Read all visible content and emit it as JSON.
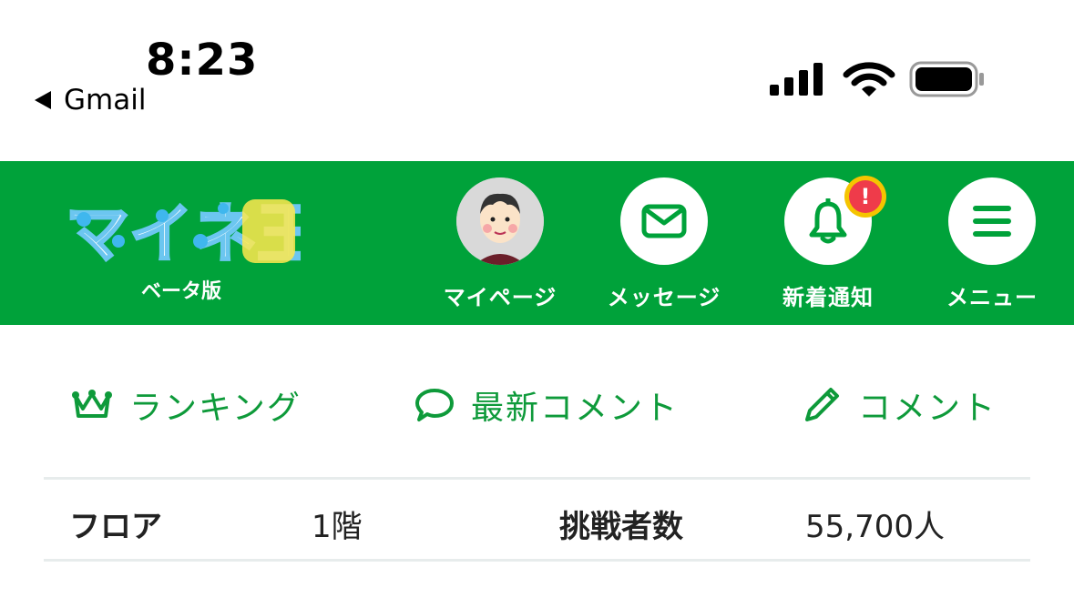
{
  "status_bar": {
    "time": "8:23",
    "back_app": "Gmail",
    "icons": [
      "cellular-signal-icon",
      "wifi-icon",
      "battery-icon"
    ]
  },
  "header": {
    "logo_text": "マイネ王",
    "logo_sub": "ベータ版",
    "nav": [
      {
        "label": "マイページ",
        "icon": "avatar"
      },
      {
        "label": "メッセージ",
        "icon": "mail-icon"
      },
      {
        "label": "新着通知",
        "icon": "bell-icon",
        "badge": "!"
      },
      {
        "label": "メニュー",
        "icon": "hamburger-icon"
      }
    ],
    "colors": {
      "brand": "#00a23a",
      "badge_outer": "#f5c400",
      "badge_inner": "#ef3b4a"
    }
  },
  "sub_nav": [
    {
      "label": "ランキング",
      "icon": "crown-icon"
    },
    {
      "label": "最新コメント",
      "icon": "speech-bubble-icon"
    },
    {
      "label": "コメント",
      "icon": "pencil-icon"
    }
  ],
  "info": {
    "floor_label": "フロア",
    "floor_value": "1階",
    "challengers_label": "挑戦者数",
    "challengers_value": "55,700人"
  }
}
